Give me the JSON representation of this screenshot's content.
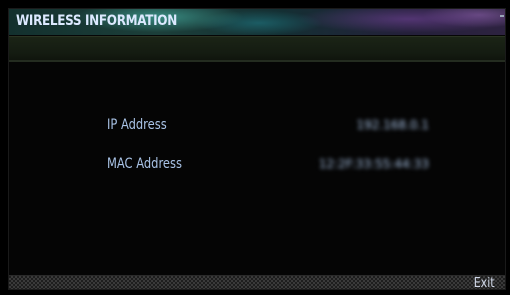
{
  "title_bar": {
    "title": "WIRELESS INFORMATION"
  },
  "info": {
    "rows": [
      {
        "label": "IP Address",
        "value": "192.168.0.1"
      },
      {
        "label": "MAC Address",
        "value": "12:2F:33:55:44:33"
      }
    ]
  },
  "footer": {
    "exit_label": "Exit"
  }
}
